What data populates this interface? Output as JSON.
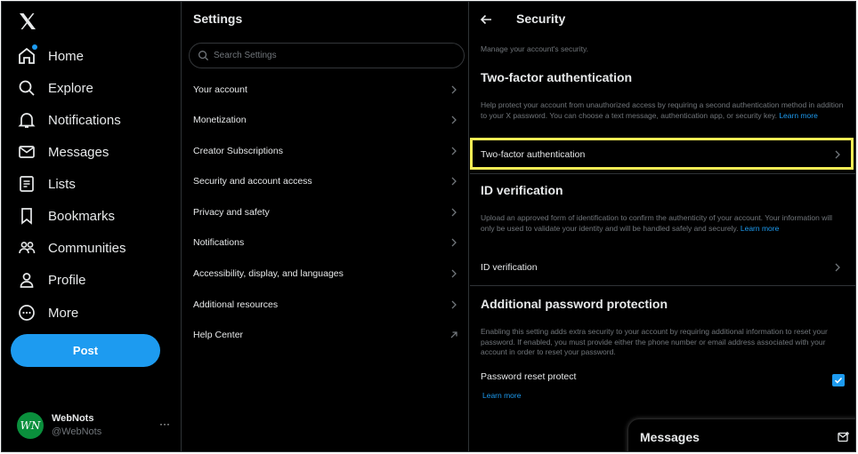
{
  "nav": {
    "logo": "x-logo-icon",
    "items": [
      {
        "label": "Home",
        "icon": "home-icon"
      },
      {
        "label": "Explore",
        "icon": "search-icon"
      },
      {
        "label": "Notifications",
        "icon": "bell-icon"
      },
      {
        "label": "Messages",
        "icon": "mail-icon"
      },
      {
        "label": "Lists",
        "icon": "list-icon"
      },
      {
        "label": "Bookmarks",
        "icon": "bookmark-icon"
      },
      {
        "label": "Communities",
        "icon": "communities-icon"
      },
      {
        "label": "Profile",
        "icon": "profile-icon"
      },
      {
        "label": "More",
        "icon": "more-circle-icon"
      }
    ],
    "post_label": "Post",
    "account": {
      "initials": "WN",
      "name": "WebNots",
      "handle": "@WebNots",
      "more": "···"
    }
  },
  "settings": {
    "title": "Settings",
    "search_placeholder": "Search Settings",
    "items": [
      {
        "label": "Your account"
      },
      {
        "label": "Monetization"
      },
      {
        "label": "Creator Subscriptions"
      },
      {
        "label": "Security and account access"
      },
      {
        "label": "Privacy and safety"
      },
      {
        "label": "Notifications"
      },
      {
        "label": "Accessibility, display, and languages"
      },
      {
        "label": "Additional resources"
      },
      {
        "label": "Help Center"
      }
    ]
  },
  "security": {
    "title": "Security",
    "subtitle": "Manage your account's security.",
    "twofa": {
      "heading": "Two-factor authentication",
      "description": "Help protect your account from unauthorized access by requiring a second authentication method in addition to your X password. You can choose a text message, authentication app, or security key.",
      "learn_more": "Learn more",
      "row_label": "Two-factor authentication"
    },
    "idv": {
      "heading": "ID verification",
      "description": "Upload an approved form of identification to confirm the authenticity of your account. Your information will only be used to validate your identity and will be handled safely and securely.",
      "learn_more": "Learn more",
      "row_label": "ID verification"
    },
    "password": {
      "heading": "Additional password protection",
      "description": "Enabling this setting adds extra security to your account by requiring additional information to reset your password. If enabled, you must provide either the phone number or email address associated with your account in order to reset your password.",
      "row_label": "Password reset protect",
      "learn_more": "Learn more",
      "checked": true
    }
  },
  "messages_drawer": {
    "title": "Messages"
  },
  "colors": {
    "accent": "#1d9bf0",
    "highlight": "#f5ec55",
    "background": "#000000"
  }
}
